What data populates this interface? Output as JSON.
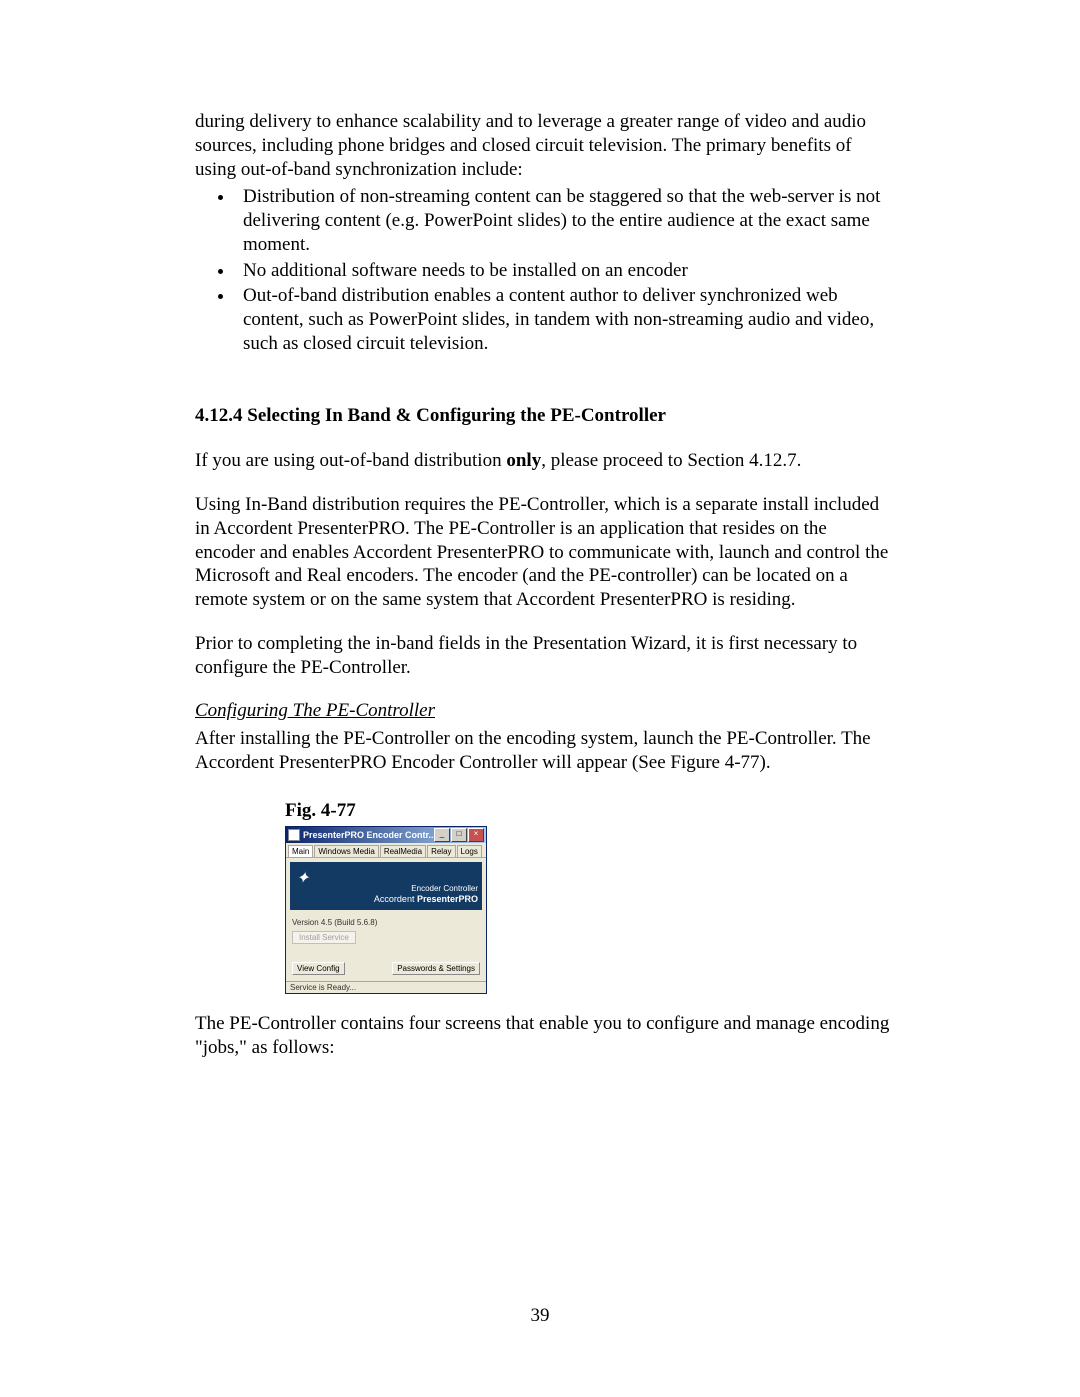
{
  "intro_paragraph": "during delivery to enhance scalability and to leverage a greater range of video and audio sources, including phone bridges and closed circuit television.  The primary benefits of using out-of-band synchronization include:",
  "bullets": [
    "Distribution of non-streaming content can be staggered so that the web-server is not delivering content (e.g. PowerPoint slides) to the entire audience at the exact same moment.",
    "No additional software needs to be installed on an encoder",
    "Out-of-band distribution enables a content author to deliver synchronized web content, such as PowerPoint slides, in tandem with non-streaming audio and video, such as closed circuit television."
  ],
  "section_heading": "4.12.4  Selecting In Band & Configuring the PE-Controller",
  "p1_pre": "If you are using out-of-band distribution ",
  "p1_bold": "only",
  "p1_post": ", please proceed to Section 4.12.7.",
  "p2": "Using In-Band distribution requires the PE-Controller, which is a separate install included in Accordent PresenterPRO.  The PE-Controller is an application that resides on the encoder and enables Accordent PresenterPRO to communicate with, launch and control the Microsoft and Real encoders.  The encoder (and the PE-controller) can be located on a remote system or on the same system that Accordent PresenterPRO is residing.",
  "p3": "Prior to completing the in-band fields in the Presentation Wizard, it is first necessary to configure the PE-Controller.",
  "sub_heading": "Configuring The PE-Controller",
  "p4": "After installing the PE-Controller on the encoding system, launch the PE-Controller.  The Accordent PresenterPRO Encoder Controller will appear (See Figure 4-77).",
  "fig_label": "Fig.  4-77",
  "dialog": {
    "title": "PresenterPRO Encoder Contr...",
    "tabs": [
      "Main",
      "Windows Media",
      "RealMedia",
      "Relay",
      "Logs"
    ],
    "banner_sub": "Encoder Controller",
    "banner_brand1": "Accordent",
    "banner_brand2": "PresenterPRO",
    "version": "Version 4.5  (Build 5.6.8)",
    "disabled_btn": "Install Service",
    "btn_left": "View Config",
    "btn_right": "Passwords & Settings",
    "status": "Service is Ready..."
  },
  "p5": "The PE-Controller contains four screens that enable you to configure and manage encoding \"jobs,\" as follows:",
  "page_number": "39"
}
